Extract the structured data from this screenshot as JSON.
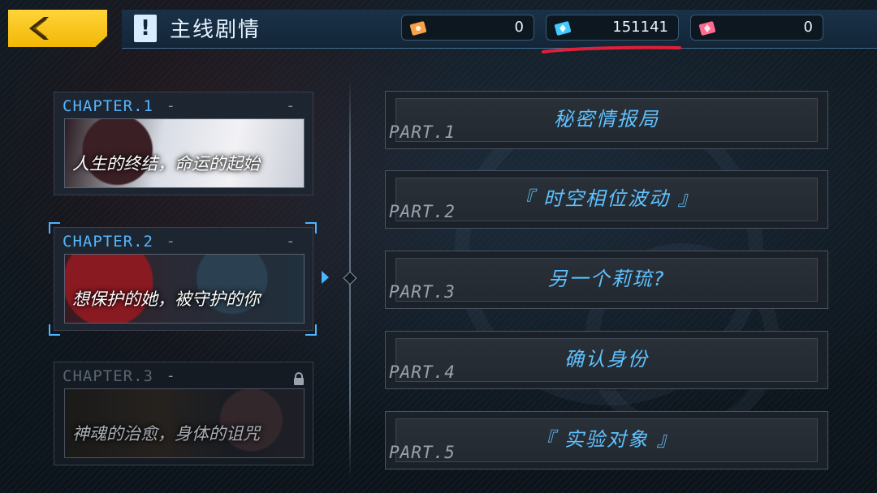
{
  "header": {
    "title": "主线剧情",
    "notice_glyph": "!"
  },
  "currencies": [
    {
      "name": "orange-ticket",
      "value": "0",
      "color": "#f7a24a"
    },
    {
      "name": "blue-crystal",
      "value": "151141",
      "color": "#45c8ff"
    },
    {
      "name": "pink-gem",
      "value": "0",
      "color": "#ff6b8f"
    }
  ],
  "chapters": [
    {
      "label": "CHAPTER.1",
      "dash_left": "-",
      "dash_right": "-",
      "subtitle": "人生的终结，命运的起始",
      "locked": false,
      "selected": false
    },
    {
      "label": "CHAPTER.2",
      "dash_left": "-",
      "dash_right": "-",
      "subtitle": "想保护的她，被守护的你",
      "locked": false,
      "selected": true
    },
    {
      "label": "CHAPTER.3",
      "dash_left": "-",
      "dash_right": "",
      "subtitle": "神魂的治愈，身体的诅咒",
      "locked": true,
      "selected": false
    }
  ],
  "parts": [
    {
      "num": "PART.1",
      "title": "秘密情报局"
    },
    {
      "num": "PART.2",
      "title": "『 时空相位波动 』"
    },
    {
      "num": "PART.3",
      "title": "另一个莉琉?"
    },
    {
      "num": "PART.4",
      "title": "确认身份"
    },
    {
      "num": "PART.5",
      "title": "『 实验对象 』"
    }
  ],
  "colors": {
    "accent": "#4db4ff",
    "back_button": "#f5c21a",
    "annotation_underline": "#e0203a"
  }
}
